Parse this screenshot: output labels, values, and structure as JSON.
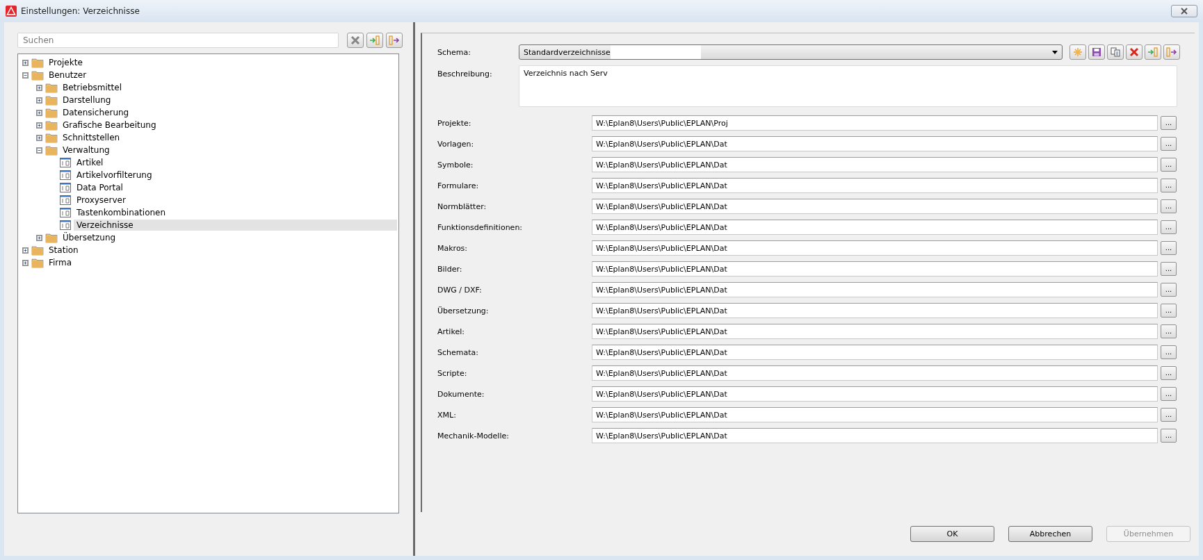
{
  "window": {
    "title": "Einstellungen: Verzeichnisse"
  },
  "search": {
    "placeholder": "Suchen"
  },
  "tree": [
    {
      "label": "Projekte",
      "kind": "folder",
      "expanded": false,
      "selected": false
    },
    {
      "label": "Benutzer",
      "kind": "folder",
      "expanded": true,
      "selected": false,
      "children": [
        {
          "label": "Betriebsmittel",
          "kind": "folder",
          "expanded": false,
          "selected": false
        },
        {
          "label": "Darstellung",
          "kind": "folder",
          "expanded": false,
          "selected": false
        },
        {
          "label": "Datensicherung",
          "kind": "folder",
          "expanded": false,
          "selected": false
        },
        {
          "label": "Grafische Bearbeitung",
          "kind": "folder",
          "expanded": false,
          "selected": false
        },
        {
          "label": "Schnittstellen",
          "kind": "folder",
          "expanded": false,
          "selected": false
        },
        {
          "label": "Verwaltung",
          "kind": "folder",
          "expanded": true,
          "selected": false,
          "children": [
            {
              "label": "Artikel",
              "kind": "page",
              "selected": false
            },
            {
              "label": "Artikelvorfilterung",
              "kind": "page",
              "selected": false
            },
            {
              "label": "Data Portal",
              "kind": "page",
              "selected": false
            },
            {
              "label": "Proxyserver",
              "kind": "page",
              "selected": false
            },
            {
              "label": "Tastenkombinationen",
              "kind": "page",
              "selected": false
            },
            {
              "label": "Verzeichnisse",
              "kind": "page",
              "selected": true
            }
          ]
        },
        {
          "label": "Übersetzung",
          "kind": "folder",
          "expanded": false,
          "selected": false
        }
      ]
    },
    {
      "label": "Station",
      "kind": "folder",
      "expanded": false,
      "selected": false
    },
    {
      "label": "Firma",
      "kind": "folder",
      "expanded": false,
      "selected": false
    }
  ],
  "schema": {
    "label": "Schema:",
    "value": "Standardverzeichnisse"
  },
  "description": {
    "label": "Beschreibung:",
    "value": "Verzeichnis nach Serv"
  },
  "paths": [
    {
      "label": "Projekte:",
      "value": "W:\\Eplan8\\Users\\Public\\EPLAN\\Proj"
    },
    {
      "label": "Vorlagen:",
      "value": "W:\\Eplan8\\Users\\Public\\EPLAN\\Dat"
    },
    {
      "label": "Symbole:",
      "value": "W:\\Eplan8\\Users\\Public\\EPLAN\\Dat"
    },
    {
      "label": "Formulare:",
      "value": "W:\\Eplan8\\Users\\Public\\EPLAN\\Dat"
    },
    {
      "label": "Normblätter:",
      "value": "W:\\Eplan8\\Users\\Public\\EPLAN\\Dat"
    },
    {
      "label": "Funktionsdefinitionen:",
      "value": "W:\\Eplan8\\Users\\Public\\EPLAN\\Dat"
    },
    {
      "label": "Makros:",
      "value": "W:\\Eplan8\\Users\\Public\\EPLAN\\Dat"
    },
    {
      "label": "Bilder:",
      "value": "W:\\Eplan8\\Users\\Public\\EPLAN\\Dat"
    },
    {
      "label": "DWG / DXF:",
      "value": "W:\\Eplan8\\Users\\Public\\EPLAN\\Dat"
    },
    {
      "label": "Übersetzung:",
      "value": "W:\\Eplan8\\Users\\Public\\EPLAN\\Dat"
    },
    {
      "label": "Artikel:",
      "value": "W:\\Eplan8\\Users\\Public\\EPLAN\\Dat"
    },
    {
      "label": "Schemata:",
      "value": "W:\\Eplan8\\Users\\Public\\EPLAN\\Dat"
    },
    {
      "label": "Scripte:",
      "value": "W:\\Eplan8\\Users\\Public\\EPLAN\\Dat"
    },
    {
      "label": "Dokumente:",
      "value": "W:\\Eplan8\\Users\\Public\\EPLAN\\Dat"
    },
    {
      "label": "XML:",
      "value": "W:\\Eplan8\\Users\\Public\\EPLAN\\Dat"
    },
    {
      "label": "Mechanik-Modelle:",
      "value": "W:\\Eplan8\\Users\\Public\\EPLAN\\Dat"
    }
  ],
  "browse_label": "...",
  "buttons": [
    {
      "label": "OK",
      "disabled": false
    },
    {
      "label": "Abbrechen",
      "disabled": false
    },
    {
      "label": "Übernehmen",
      "disabled": true
    }
  ]
}
